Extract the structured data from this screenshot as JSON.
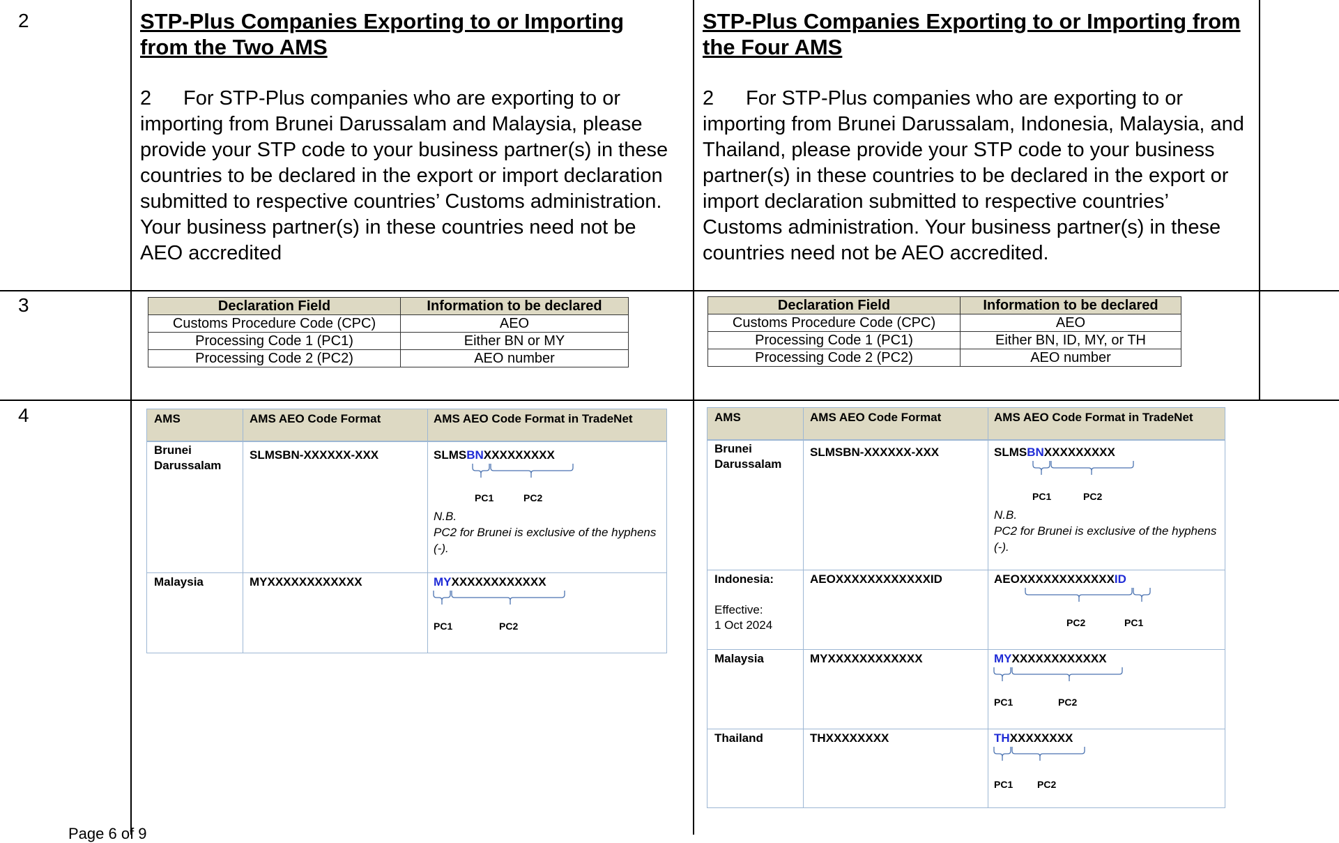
{
  "rows": [
    "2",
    "3",
    "4"
  ],
  "left": {
    "title": "STP-Plus Companies Exporting to or Importing from the Two AMS",
    "para_num": "2",
    "para_text": "For STP-Plus companies who are exporting to or importing from Brunei Darussalam and Malaysia, please provide your STP code to your business partner(s) in these countries to be declared in the export or import declaration submitted to respective countries’ Customs administration. Your business partner(s) in these countries need not be AEO accredited",
    "decl_table": {
      "headers": [
        "Declaration Field",
        "Information to be declared"
      ],
      "rows": [
        [
          "Customs Procedure Code (CPC)",
          "AEO"
        ],
        [
          "Processing Code 1 (PC1)",
          "Either BN or MY"
        ],
        [
          "Processing Code 2 (PC2)",
          "AEO number"
        ]
      ]
    }
  },
  "right": {
    "title": "STP-Plus Companies Exporting to or Importing from the Four AMS",
    "para_num": "2",
    "para_text": "For STP-Plus companies who are exporting to or importing from Brunei Darussalam, Indonesia, Malaysia, and Thailand, please provide your STP code to your business partner(s) in these countries to be declared in the export or import declaration submitted to respective countries’ Customs administration. Your business partner(s) in these countries need not be AEO accredited.",
    "decl_table": {
      "headers": [
        "Declaration Field",
        "Information to be declared"
      ],
      "rows": [
        [
          "Customs Procedure Code (CPC)",
          "AEO"
        ],
        [
          "Processing Code 1 (PC1)",
          "Either BN, ID, MY, or TH"
        ],
        [
          "Processing Code 2 (PC2)",
          "AEO number"
        ]
      ]
    }
  },
  "ams_headers": [
    "AMS",
    "AMS AEO Code Format",
    "AMS AEO Code Format in TradeNet"
  ],
  "ams": {
    "brunei_name": "Brunei Darussalam",
    "brunei_format": "SLMSBN-XXXXXX-XXX",
    "brunei_tn_a": "SLMS",
    "brunei_tn_b": "BN",
    "brunei_tn_c": "XXXXXXXXX",
    "nb1": "N.B.",
    "nb2": "PC2 for Brunei is exclusive of the hyphens (-).",
    "indo_name": "Indonesia:",
    "indo_eff1": "Effective:",
    "indo_eff2": "1 Oct 2024",
    "indo_format": "AEOXXXXXXXXXXXXID",
    "indo_tn_a": "AEOXXXXXXXXXXXX",
    "indo_tn_b": "ID",
    "malaysia_name": "Malaysia",
    "malaysia_format": "MYXXXXXXXXXXXX",
    "malaysia_tn_a": "MY",
    "malaysia_tn_b": "XXXXXXXXXXXX",
    "thai_name": "Thailand",
    "thai_format": "THXXXXXXXX",
    "thai_tn_a": "TH",
    "thai_tn_b": "XXXXXXXX",
    "pc1": "PC1",
    "pc2": "PC2"
  },
  "colors": {
    "highlight_blue": "#1f2bd6",
    "header_bg": "#ddd9c3",
    "border_blue": "#9db7d4"
  },
  "footer": "Page 6 of 9"
}
